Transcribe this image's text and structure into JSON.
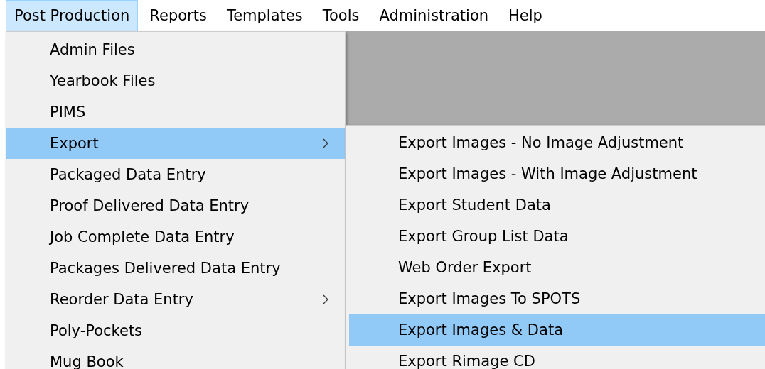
{
  "menu_bar": [
    {
      "label": "Post Production",
      "selected": true
    },
    {
      "label": "Reports",
      "selected": false
    },
    {
      "label": "Templates",
      "selected": false
    },
    {
      "label": "Tools",
      "selected": false
    },
    {
      "label": "Administration",
      "selected": false
    },
    {
      "label": "Help",
      "selected": false
    }
  ],
  "menu": {
    "items": [
      {
        "label": "Admin Files",
        "selected": false,
        "has_submenu": false
      },
      {
        "label": "Yearbook Files",
        "selected": false,
        "has_submenu": false
      },
      {
        "label": "PIMS",
        "selected": false,
        "has_submenu": false
      },
      {
        "label": "Export",
        "selected": true,
        "has_submenu": true
      },
      {
        "label": "Packaged Data Entry",
        "selected": false,
        "has_submenu": false
      },
      {
        "label": "Proof Delivered Data Entry",
        "selected": false,
        "has_submenu": false
      },
      {
        "label": "Job Complete Data Entry",
        "selected": false,
        "has_submenu": false
      },
      {
        "label": "Packages Delivered Data Entry",
        "selected": false,
        "has_submenu": false
      },
      {
        "label": "Reorder Data Entry",
        "selected": false,
        "has_submenu": true
      },
      {
        "label": "Poly-Pockets",
        "selected": false,
        "has_submenu": false
      },
      {
        "label": "Mug Book",
        "selected": false,
        "has_submenu": false
      }
    ]
  },
  "submenu": {
    "items": [
      {
        "label": "Export Images - No Image Adjustment",
        "selected": false
      },
      {
        "label": "Export Images - With Image Adjustment",
        "selected": false
      },
      {
        "label": "Export Student Data",
        "selected": false
      },
      {
        "label": "Export Group List Data",
        "selected": false
      },
      {
        "label": "Web Order Export",
        "selected": false
      },
      {
        "label": "Export Images To SPOTS",
        "selected": false
      },
      {
        "label": "Export Images & Data",
        "selected": true
      },
      {
        "label": "Export Rimage CD",
        "selected": false
      }
    ]
  }
}
